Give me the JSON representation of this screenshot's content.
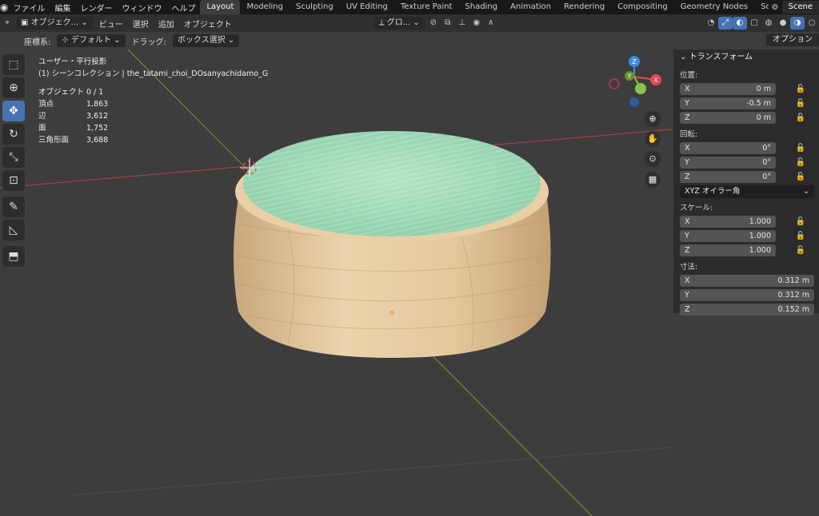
{
  "menu": [
    "ファイル",
    "編集",
    "レンダー",
    "ウィンドウ",
    "ヘルプ"
  ],
  "workspaces": [
    {
      "label": "Layout",
      "active": true
    },
    {
      "label": "Modeling"
    },
    {
      "label": "Sculpting"
    },
    {
      "label": "UV Editing"
    },
    {
      "label": "Texture Paint"
    },
    {
      "label": "Shading"
    },
    {
      "label": "Animation"
    },
    {
      "label": "Rendering"
    },
    {
      "label": "Compositing"
    },
    {
      "label": "Geometry Nodes"
    },
    {
      "label": "Scripting"
    }
  ],
  "add_workspace": "+",
  "scene": "Scene",
  "header": {
    "mode": "オブジェク...",
    "view": "ビュー",
    "select": "選択",
    "add": "追加",
    "object": "オブジェクト",
    "transform_orientation": "グロ..."
  },
  "subheader": {
    "coord_label": "座標系:",
    "coord_value": "デフォルト",
    "drag_label": "ドラッグ:",
    "drag_value": "ボックス選択",
    "options": "オプション"
  },
  "overlay": {
    "view_name": "ユーザー・平行投影",
    "collection": "(1) シーンコレクション | the_tatami_choi_DOsanyachidamo_G"
  },
  "stats": [
    {
      "key": "オブジェクト",
      "value": "0 / 1"
    },
    {
      "key": "頂点",
      "value": "1,863"
    },
    {
      "key": "辺",
      "value": "3,612"
    },
    {
      "key": "面",
      "value": "1,752"
    },
    {
      "key": "三角形面",
      "value": "3,688"
    }
  ],
  "gizmo": {
    "x": "X",
    "y": "Y",
    "z": "Z"
  },
  "npanel": {
    "title": "トランスフォーム",
    "location_label": "位置:",
    "location": [
      {
        "axis": "X",
        "value": "0 m"
      },
      {
        "axis": "Y",
        "value": "-0.5 m"
      },
      {
        "axis": "Z",
        "value": "0 m"
      }
    ],
    "rotation_label": "回転:",
    "rotation": [
      {
        "axis": "X",
        "value": "0°"
      },
      {
        "axis": "Y",
        "value": "0°"
      },
      {
        "axis": "Z",
        "value": "0°"
      }
    ],
    "rotation_mode": "XYZ オイラー角",
    "scale_label": "スケール:",
    "scale": [
      {
        "axis": "X",
        "value": "1.000"
      },
      {
        "axis": "Y",
        "value": "1.000"
      },
      {
        "axis": "Z",
        "value": "1.000"
      }
    ],
    "dimensions_label": "寸法:",
    "dimensions": [
      {
        "axis": "X",
        "value": "0.312 m"
      },
      {
        "axis": "Y",
        "value": "0.312 m"
      },
      {
        "axis": "Z",
        "value": "0.152 m"
      }
    ]
  },
  "colors": {
    "accent": "#4772b3",
    "x_axis": "#e84456",
    "y_axis": "#8bc34a",
    "z_axis": "#3d8bdf",
    "tatami": "#a8dcc0",
    "wood": "#e6c9a0"
  }
}
